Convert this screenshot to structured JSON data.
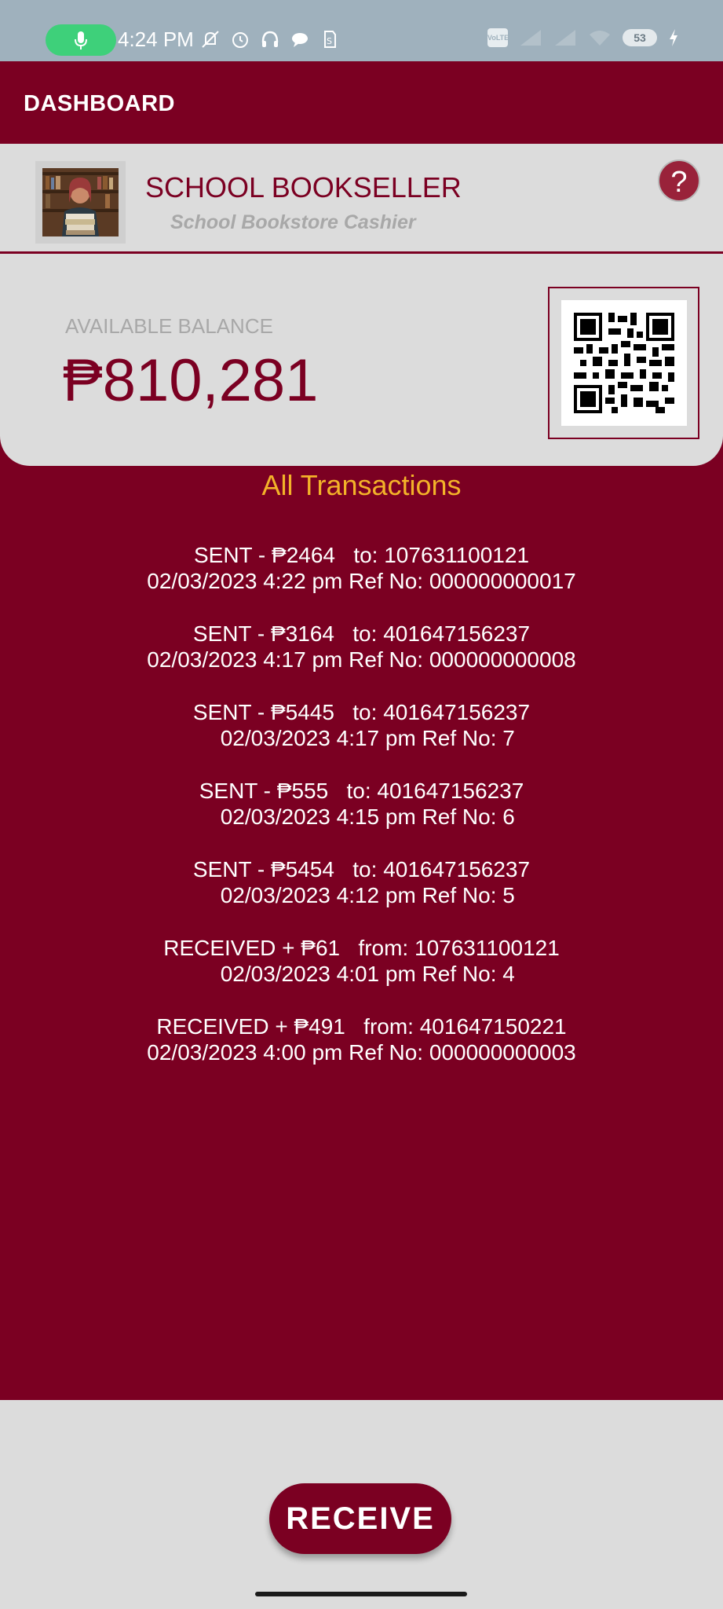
{
  "status_bar": {
    "time": "4:24 PM",
    "battery_level": "53",
    "icons": [
      "mic-icon",
      "mute-icon",
      "alarm-icon",
      "headphones-icon",
      "chat-icon",
      "sim-icon",
      "volte-icon",
      "signal-icon",
      "wifi-icon",
      "battery-icon",
      "charging-icon"
    ]
  },
  "app_bar": {
    "title": "DASHBOARD"
  },
  "profile": {
    "name": "SCHOOL BOOKSELLER",
    "role": "School Bookstore Cashier",
    "help_label": "?"
  },
  "balance": {
    "label": "AVAILABLE BALANCE",
    "value": "₱810,281"
  },
  "transactions": {
    "title": "All Transactions",
    "items": [
      {
        "line1": "SENT - ₱2464   to: 107631100121",
        "line2": "02/03/2023 4:22 pm Ref No: 000000000017"
      },
      {
        "line1": "SENT - ₱3164   to: 401647156237",
        "line2": "02/03/2023 4:17 pm Ref No: 000000000008"
      },
      {
        "line1": "SENT - ₱5445   to: 401647156237",
        "line2": "  02/03/2023 4:17 pm Ref No: 7"
      },
      {
        "line1": "SENT - ₱555   to: 401647156237",
        "line2": "  02/03/2023 4:15 pm Ref No: 6"
      },
      {
        "line1": "SENT - ₱5454   to: 401647156237",
        "line2": "  02/03/2023 4:12 pm Ref No: 5"
      },
      {
        "line1": "RECEIVED + ₱61   from: 107631100121",
        "line2": "  02/03/2023 4:01 pm Ref No: 4"
      },
      {
        "line1": "RECEIVED + ₱491   from: 401647150221",
        "line2": "02/03/2023 4:00 pm Ref No: 000000000003"
      }
    ]
  },
  "actions": {
    "receive_label": "RECEIVE"
  },
  "colors": {
    "primary": "#7b0022",
    "accent": "#f3b229",
    "card": "#dcdcdc",
    "status_bar": "#9fb1bd"
  }
}
